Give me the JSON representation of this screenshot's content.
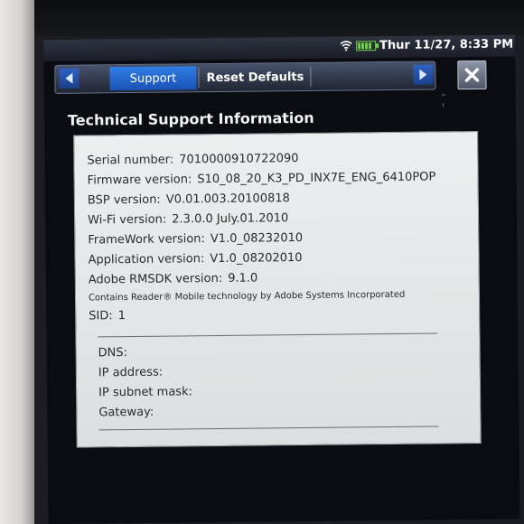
{
  "status_bar": {
    "datetime": "Thur 11/27, 8:33 PM",
    "wifi_icon": "wifi-icon",
    "battery_icon": "battery-icon"
  },
  "tabs": [
    {
      "label": "Support",
      "active": true
    },
    {
      "label": "Reset Defaults",
      "active": false
    }
  ],
  "section_title": "Technical Support Information",
  "info_rows": [
    {
      "label": "Serial number:",
      "value": "7010000910722090"
    },
    {
      "label": "Firmware version:",
      "value": "S10_08_20_K3_PD_INX7E_ENG_6410POP"
    },
    {
      "label": "BSP version:",
      "value": "V0.01.003.20100818"
    },
    {
      "label": "Wi-Fi version:",
      "value": "2.3.0.0 July.01.2010"
    },
    {
      "label": "FrameWork version:",
      "value": "V1.0_08232010"
    },
    {
      "label": "Application version:",
      "value": "V1.0_08202010"
    },
    {
      "label": "Adobe RMSDK version:",
      "value": "9.1.0"
    }
  ],
  "adobe_notice": "Contains Reader® Mobile technology by Adobe Systems Incorporated",
  "sid": {
    "label": "SID:",
    "value": "1"
  },
  "network_rows": [
    {
      "label": "DNS:",
      "value": ""
    },
    {
      "label": "IP address:",
      "value": ""
    },
    {
      "label": "IP subnet mask:",
      "value": ""
    },
    {
      "label": "Gateway:",
      "value": ""
    }
  ],
  "colors": {
    "active_tab": "#2f7ee6",
    "panel_bg": "#e4e6e7",
    "battery": "#6fd24a"
  }
}
